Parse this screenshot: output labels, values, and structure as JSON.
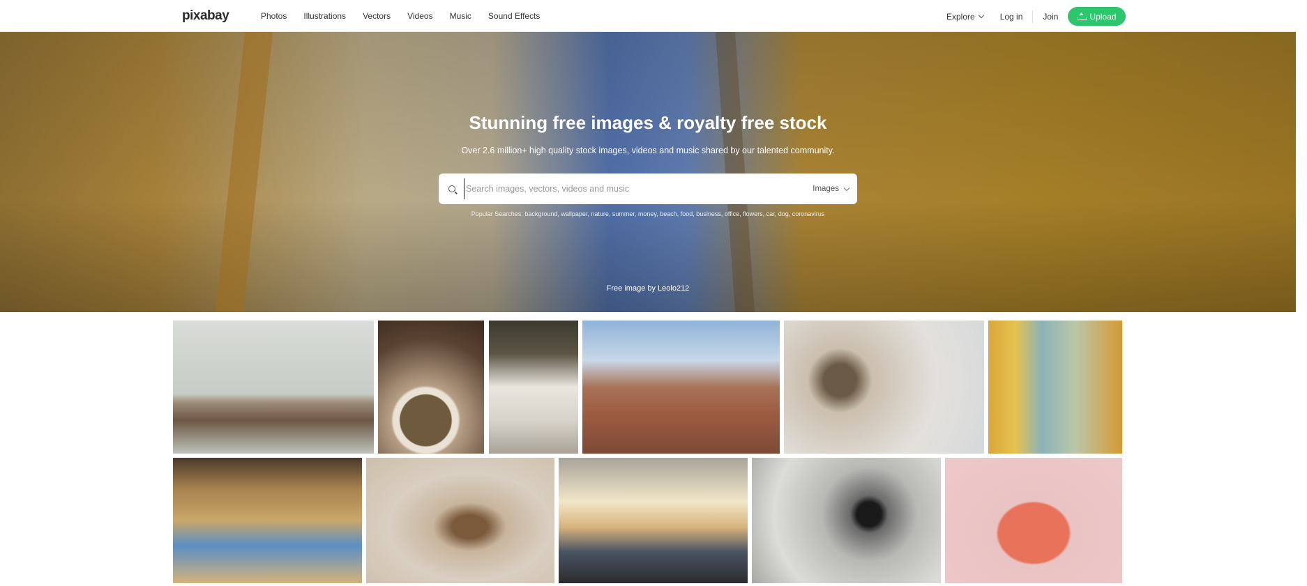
{
  "header": {
    "logo": "pixabay",
    "nav": [
      "Photos",
      "Illustrations",
      "Vectors",
      "Videos",
      "Music",
      "Sound Effects"
    ],
    "explore": "Explore",
    "login": "Log in",
    "join": "Join",
    "upload": "Upload"
  },
  "hero": {
    "title": "Stunning free images & royalty free stock",
    "subtitle": "Over 2.6 million+ high quality stock images, videos and music shared by our talented community.",
    "search_placeholder": "Search images, vectors, videos and music",
    "search_type": "Images",
    "popular_label": "Popular Searches:",
    "popular": "background, wallpaper, nature, summer, money, beach, food, business, office, flowers, car, dog, coronavirus",
    "credit": "Free image by Leolo212"
  },
  "gallery": {
    "images": [
      "cat-sleeping-photo",
      "food-bowl-photo",
      "family-photo",
      "city-rooftops-photo",
      "dried-flower-photo",
      "fox-illustration",
      "baskets-photo",
      "sparrow-photo",
      "graduation-couple-photo",
      "horse-eye-photo",
      "fox-flowers-illustration"
    ]
  }
}
